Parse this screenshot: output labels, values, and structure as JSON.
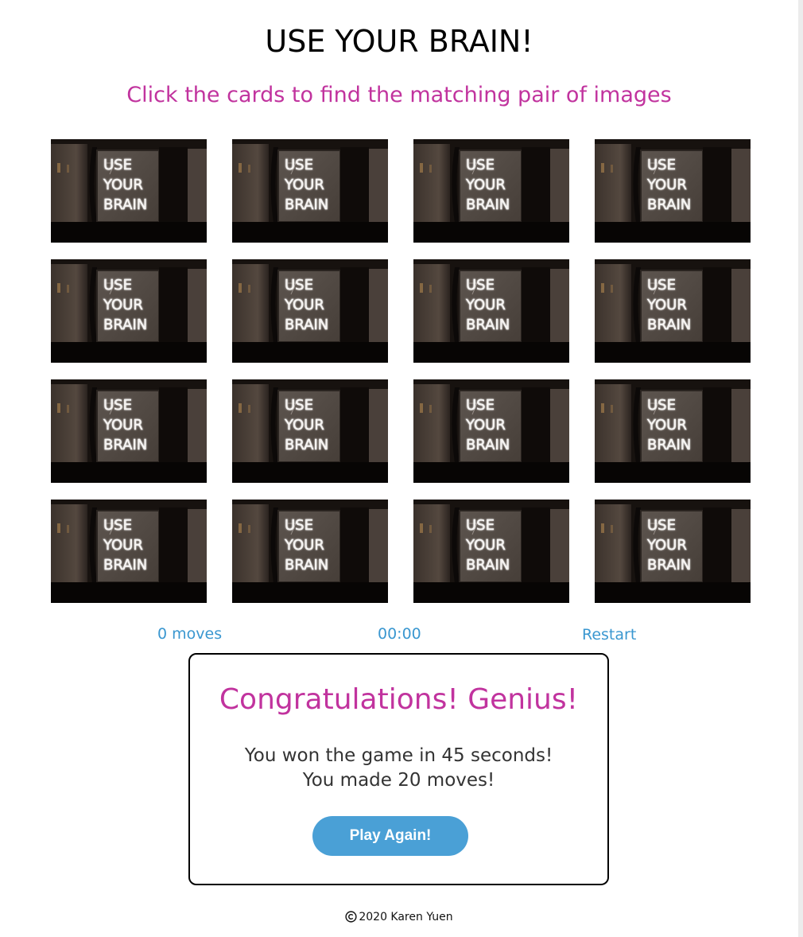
{
  "header": {
    "title": "USE YOUR BRAIN!",
    "subtitle": "Click the cards to find the matching pair of images"
  },
  "cards": {
    "count": 16,
    "back_text": [
      "USE",
      "YOUR",
      "BRAIN"
    ],
    "state": "face-down"
  },
  "stats": {
    "moves": "0 moves",
    "timer": "00:00",
    "restart": "Restart"
  },
  "modal": {
    "title": "Congratulations! Genius!",
    "line1": "You won the game in 45 seconds!",
    "line2": "You made 20 moves!",
    "button": "Play Again!"
  },
  "footer": {
    "text": "2020 Karen Yuen",
    "icon": "copyright-icon"
  },
  "colors": {
    "accent_pink": "#c1339e",
    "accent_blue": "#3a97d0",
    "button_blue": "#4aa0d6"
  }
}
